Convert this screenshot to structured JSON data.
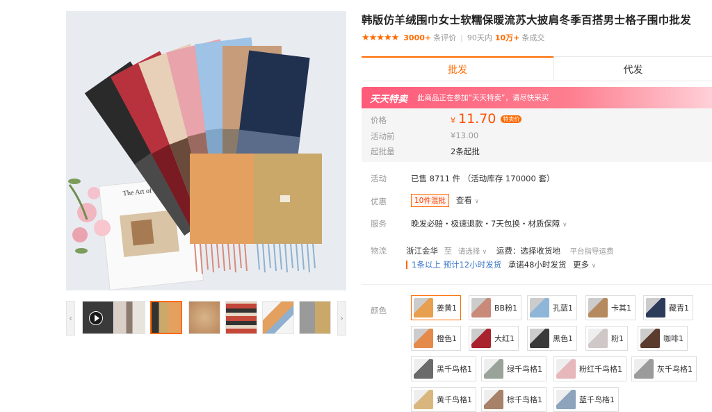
{
  "product": {
    "title": "韩版仿羊绒围巾女士软糯保暖流苏大披肩冬季百搭男士格子围巾批发",
    "stars": "★★★★★",
    "reviews_count": "3000+",
    "reviews_label": "条评价",
    "sales_period": "90天内",
    "sales_count": "10万+",
    "sales_label": "条成交"
  },
  "tabs": [
    {
      "label": "批发"
    },
    {
      "label": "代发"
    }
  ],
  "promo": {
    "logo": "天天特卖",
    "text": "此商品正在参加“天天特卖”，请尽快采买"
  },
  "price": {
    "price_label": "价格",
    "currency": "¥",
    "value": "11.70",
    "tag": "特卖价",
    "original_label": "活动前",
    "original_value": "¥13.00",
    "moq_label": "起批量",
    "moq_value": "2条起批"
  },
  "info": {
    "activity_label": "活动",
    "activity_value": "已售 8711 件 （活动库存 170000 套）",
    "discount_label": "优惠",
    "discount_tag": "10件混批",
    "discount_link": "查看",
    "service_label": "服务",
    "service_value": "晚发必赔・极速退款・7天包换・材质保障",
    "logistics_label": "物流",
    "origin": "浙江金华",
    "to_label": "至",
    "to_select": "请选择",
    "freight": "运费：选择收货地",
    "freight_hint": "平台指导运费",
    "ship_fast": "1条以上 预计12小时发货",
    "ship_normal": "承诺48小时发货",
    "more": "更多",
    "color_label": "颜色"
  },
  "colors": [
    {
      "label": "姜黄1",
      "swatch": "#e6a050"
    },
    {
      "label": "BB粉1",
      "swatch": "#c98a7a"
    },
    {
      "label": "孔蓝1",
      "swatch": "#8fb6d8"
    },
    {
      "label": "卡其1",
      "swatch": "#b58a5e"
    },
    {
      "label": "藏青1",
      "swatch": "#2d3b5a"
    },
    {
      "label": "橙色1",
      "swatch": "#e48a4a"
    },
    {
      "label": "大红1",
      "swatch": "#a8232d"
    },
    {
      "label": "黑色1",
      "swatch": "#3a3a3a"
    },
    {
      "label": "粉1",
      "swatch": "#cfc8c6"
    },
    {
      "label": "咖啡1",
      "swatch": "#5a3b2e"
    },
    {
      "label": "黑千鸟格1",
      "swatch": "#6a6a6a"
    },
    {
      "label": "绿千鸟格1",
      "swatch": "#9aa39a"
    },
    {
      "label": "粉红千鸟格1",
      "swatch": "#e6b7bb"
    },
    {
      "label": "灰千鸟格1",
      "swatch": "#9b9b9b"
    },
    {
      "label": "黄千鸟格1",
      "swatch": "#d9b67e"
    },
    {
      "label": "棕千鸟格1",
      "swatch": "#a78268"
    },
    {
      "label": "蓝千鸟格1",
      "swatch": "#8ea4bd"
    }
  ],
  "gallery": {
    "book_text": "The Art of E"
  },
  "theme": {
    "accent": "#ff6a00",
    "promo": "#ff5a79",
    "price": "#ff5000"
  }
}
